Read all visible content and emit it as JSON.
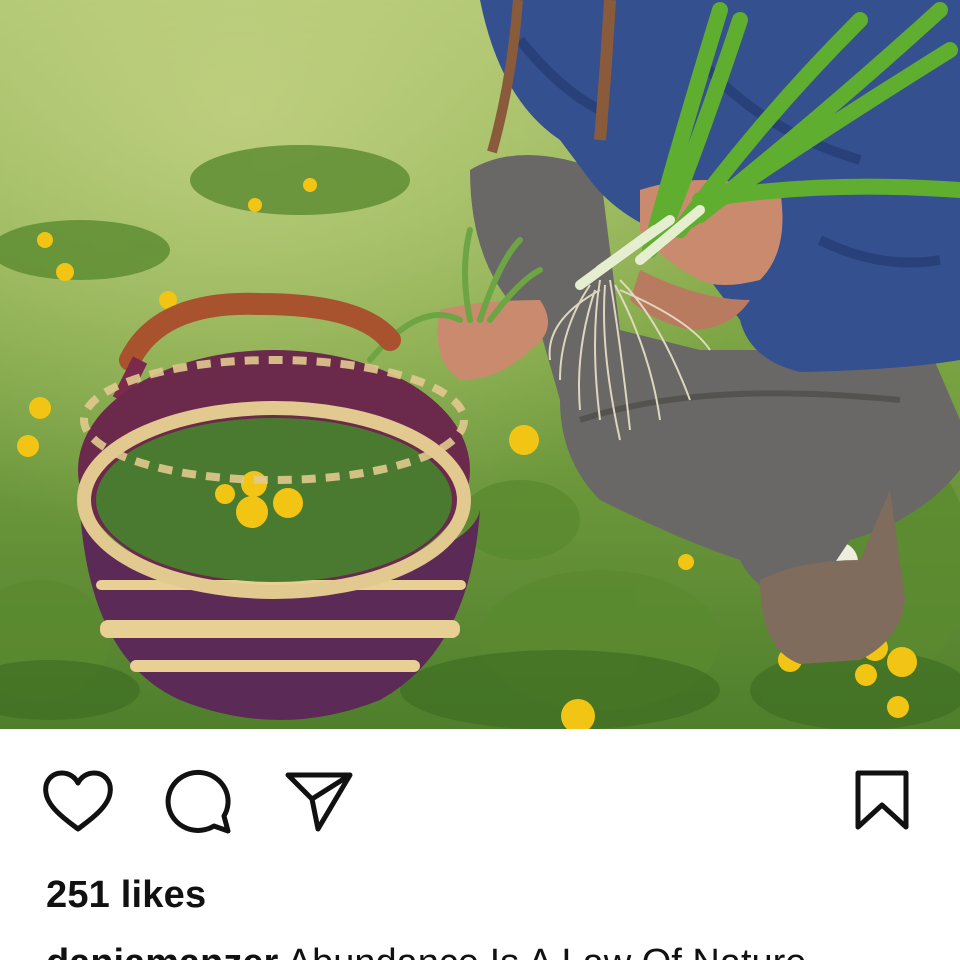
{
  "post": {
    "image_alt": "Person kneeling in a field holding freshly pulled green onions beside a woven basket of dandelion greens",
    "actions": {
      "like_icon": "heart-icon",
      "comment_icon": "comment-bubble-icon",
      "share_icon": "paper-plane-icon",
      "save_icon": "bookmark-icon"
    },
    "likes_text": "251 likes",
    "caption": {
      "username": "daniamanzer",
      "text": "Abundance Is A Law Of Nature"
    }
  },
  "colors": {
    "icon": "#111111",
    "text": "#111111",
    "background": "#ffffff"
  }
}
